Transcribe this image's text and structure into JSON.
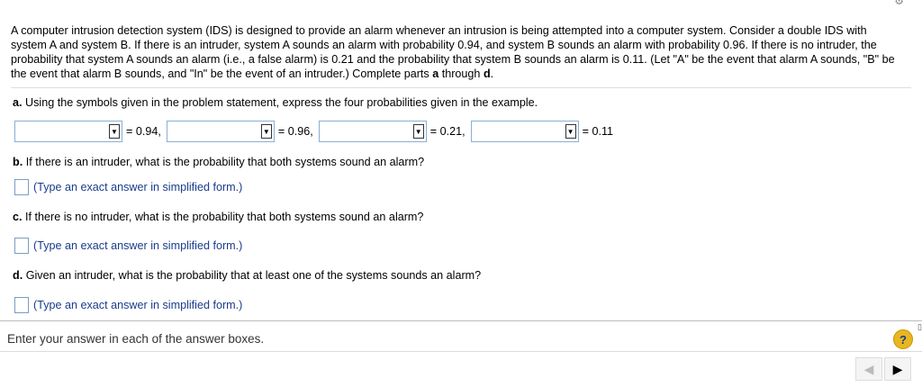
{
  "problem_text": "A computer intrusion detection system (IDS) is designed to provide an alarm whenever an intrusion is being attempted into a computer system. Consider a double IDS with system A and system B. If there is an intruder, system A sounds an alarm with probability 0.94, and system B sounds an alarm with probability 0.96. If there is no intruder, the probability that system A sounds an alarm (i.e., a false alarm) is 0.21 and the probability that system B sounds an alarm is 0.11. (Let \"A\" be the event that alarm A sounds, \"B\" be the event that alarm B sounds, and \"In\" be the event of an intruder.) Complete parts ",
  "problem_bold_a": "a",
  "problem_through": " through ",
  "problem_bold_d": "d",
  "problem_end": ".",
  "part_a": {
    "letter": "a.",
    "text": " Using the symbols given in the problem statement, express the four probabilities given in the example."
  },
  "dropdowns": [
    {
      "value": "",
      "suffix": "= 0.94,"
    },
    {
      "value": "",
      "suffix": "= 0.96,"
    },
    {
      "value": "",
      "suffix": "= 0.21,"
    },
    {
      "value": "",
      "suffix": "= 0.11"
    }
  ],
  "part_b": {
    "letter": "b.",
    "text": " If there is an intruder, what is the probability that both systems sound an alarm?"
  },
  "part_c": {
    "letter": "c.",
    "text": " If there is no intruder, what is the probability that both systems sound an alarm?"
  },
  "part_d": {
    "letter": "d.",
    "text": " Given an intruder, what is the probability that at least one of the systems sounds an alarm?"
  },
  "answer_hint": "(Type an exact answer in simplified form.)",
  "footer_text": "Enter your answer in each of the answer boxes.",
  "help_label": "?",
  "nav": {
    "prev": "◀",
    "next": "▶"
  },
  "icons": {
    "help": "help-icon",
    "gear": "gear-icon",
    "dropdown": "chevron-down-icon"
  },
  "colors": {
    "hint_blue": "#1a3c8c",
    "help_bg": "#e8b620",
    "input_border": "#8aaed4"
  }
}
